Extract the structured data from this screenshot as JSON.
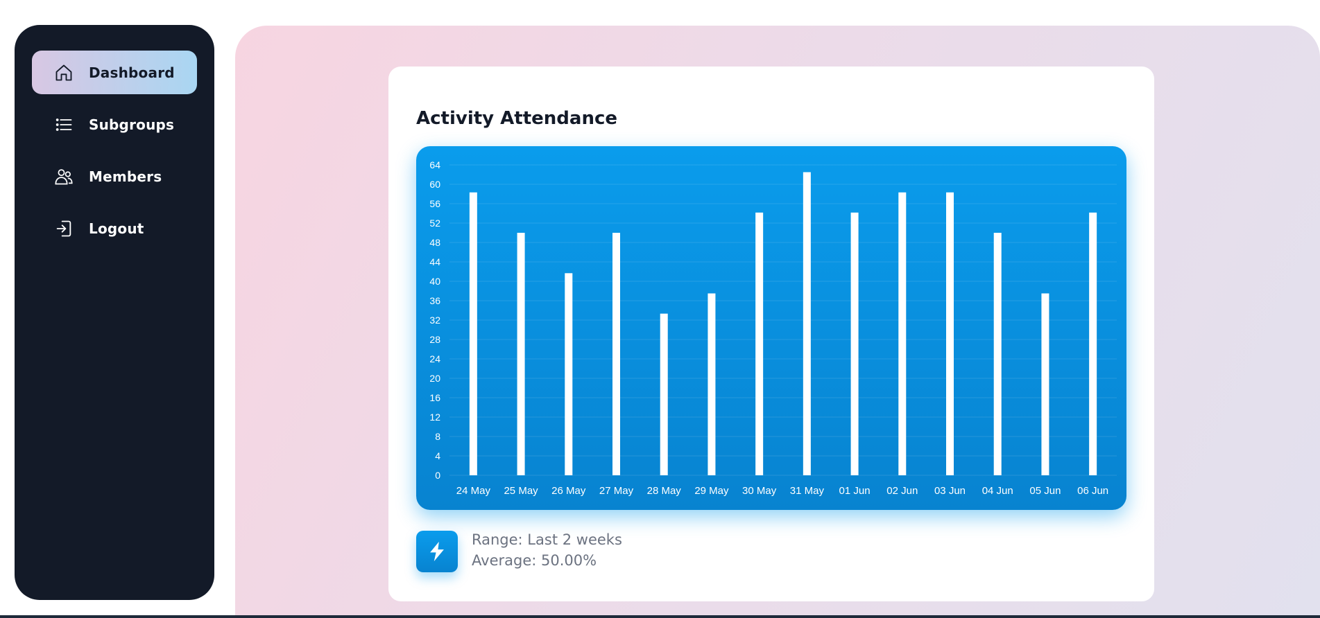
{
  "sidebar": {
    "items": [
      {
        "label": "Dashboard",
        "icon": "home-icon",
        "active": true
      },
      {
        "label": "Subgroups",
        "icon": "list-icon",
        "active": false
      },
      {
        "label": "Members",
        "icon": "users-icon",
        "active": false
      },
      {
        "label": "Logout",
        "icon": "logout-icon",
        "active": false
      }
    ]
  },
  "card": {
    "title": "Activity Attendance",
    "range_text": "Range: Last 2 weeks",
    "average_text": "Average: 50.00%",
    "footer_icon": "lightning-icon"
  },
  "colors": {
    "sidebar_bg": "#131a28",
    "accent": "#0a9cec",
    "active_gradient_start": "#d8c7e3",
    "active_gradient_end": "#a9d6f2"
  },
  "chart_data": {
    "type": "bar",
    "categories": [
      "24 May",
      "25 May",
      "26 May",
      "27 May",
      "28 May",
      "29 May",
      "30 May",
      "31 May",
      "01 Jun",
      "02 Jun",
      "03 Jun",
      "04 Jun",
      "05 Jun",
      "06 Jun"
    ],
    "values": [
      58.33,
      50,
      41.67,
      50,
      33.33,
      37.5,
      54.17,
      62.5,
      54.17,
      58.33,
      58.33,
      50,
      37.5,
      54.17
    ],
    "ylim": [
      0,
      64
    ],
    "yticks": [
      0,
      4,
      8,
      12,
      16,
      20,
      24,
      28,
      32,
      36,
      40,
      44,
      48,
      52,
      56,
      60,
      64
    ],
    "grid": true
  }
}
